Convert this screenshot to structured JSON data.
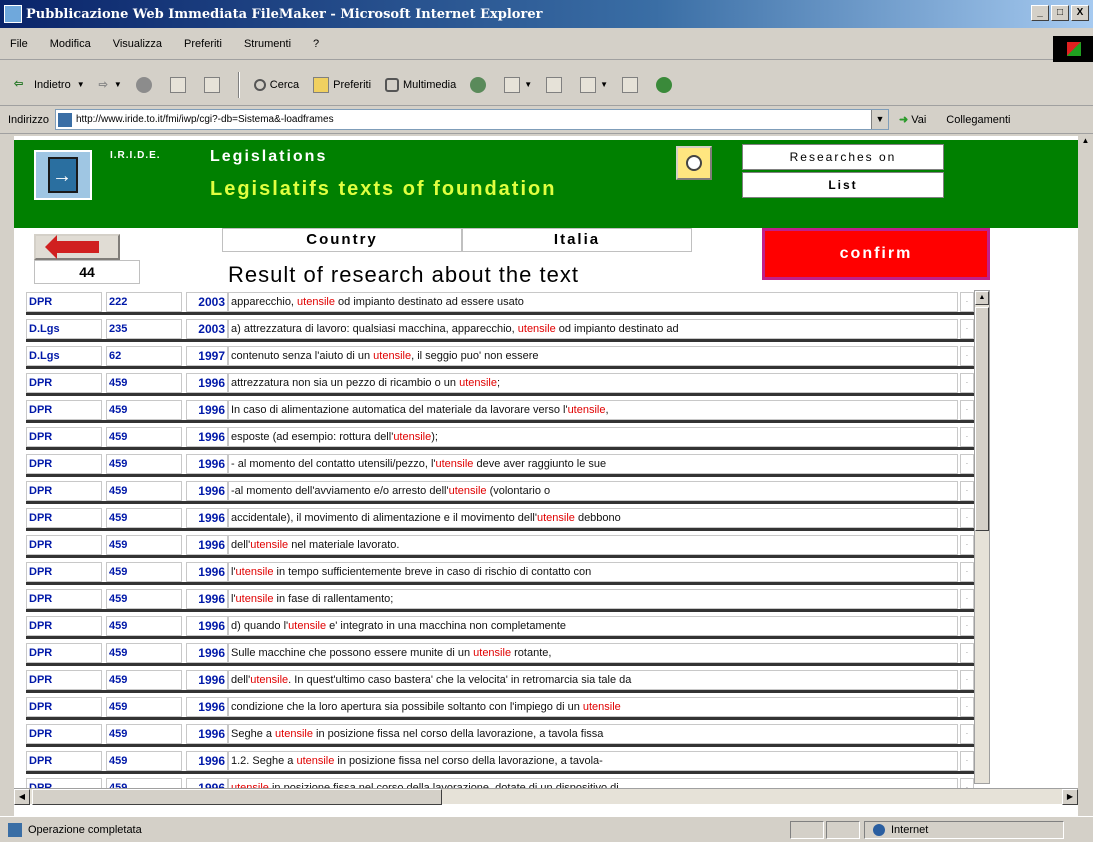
{
  "window": {
    "title": "Pubblicazione Web Immediata FileMaker - Microsoft Internet Explorer",
    "minimize": "_",
    "maximize": "□",
    "close": "X"
  },
  "menu": [
    "File",
    "Modifica",
    "Visualizza",
    "Preferiti",
    "Strumenti",
    "?"
  ],
  "toolbar": {
    "back": "Indietro",
    "search": "Cerca",
    "favorites": "Preferiti",
    "multimedia": "Multimedia"
  },
  "address": {
    "label": "Indirizzo",
    "url": "http://www.iride.to.it/fmi/iwp/cgi?-db=Sistema&-loadframes",
    "go": "Vai",
    "links": "Collegamenti"
  },
  "page": {
    "org": "I.R.I.D.E.",
    "section": "Legislations",
    "subtitle": "Legislatifs texts of foundation",
    "researches_label": "Researches on",
    "list_label": "List",
    "country_label": "Country",
    "country_value": "Italia",
    "confirm_label": "confirm",
    "result_count": "44",
    "result_title": "Result of research about the text"
  },
  "results": [
    {
      "type": "DPR",
      "number": "222",
      "year": "2003",
      "pre": "apparecchio, ",
      "hl": "utensile",
      "post": " od impianto destinato ad essere usato"
    },
    {
      "type": "D.Lgs",
      "number": "235",
      "year": "2003",
      "pre": "a) attrezzatura di lavoro: qualsiasi macchina, apparecchio, ",
      "hl": "utensile",
      "post": " od impianto destinato ad"
    },
    {
      "type": "D.Lgs",
      "number": "62",
      "year": "1997",
      "pre": "contenuto senza l'aiuto di un ",
      "hl": "utensile",
      "post": ", il seggio puo' non essere"
    },
    {
      "type": "DPR",
      "number": "459",
      "year": "1996",
      "pre": "attrezzatura non sia un pezzo di ricambio o un ",
      "hl": "utensile",
      "post": ";"
    },
    {
      "type": "DPR",
      "number": "459",
      "year": "1996",
      "pre": "In caso di alimentazione automatica del materiale da lavorare verso l'",
      "hl": "utensile",
      "post": ","
    },
    {
      "type": "DPR",
      "number": "459",
      "year": "1996",
      "pre": "esposte (ad esempio: rottura dell'",
      "hl": "utensile",
      "post": ");"
    },
    {
      "type": "DPR",
      "number": "459",
      "year": "1996",
      "pre": "- al momento del contatto utensili/pezzo, l'",
      "hl": "utensile",
      "post": " deve aver raggiunto le sue"
    },
    {
      "type": "DPR",
      "number": "459",
      "year": "1996",
      "pre": "-al momento dell'avviamento e/o arresto dell'",
      "hl": "utensile",
      "post": " (volontario o"
    },
    {
      "type": "DPR",
      "number": "459",
      "year": "1996",
      "pre": "accidentale), il movimento di alimentazione e il movimento dell'",
      "hl": "utensile",
      "post": " debbono"
    },
    {
      "type": "DPR",
      "number": "459",
      "year": "1996",
      "pre": "dell'",
      "hl": "utensile",
      "post": " nel materiale lavorato."
    },
    {
      "type": "DPR",
      "number": "459",
      "year": "1996",
      "pre": "l'",
      "hl": "utensile",
      "post": " in tempo sufficientemente breve in caso di rischio di contatto con"
    },
    {
      "type": "DPR",
      "number": "459",
      "year": "1996",
      "pre": "l'",
      "hl": "utensile",
      "post": " in fase di rallentamento;"
    },
    {
      "type": "DPR",
      "number": "459",
      "year": "1996",
      "pre": "d) quando l'",
      "hl": "utensile",
      "post": " e' integrato in una macchina non completamente"
    },
    {
      "type": "DPR",
      "number": "459",
      "year": "1996",
      "pre": "Sulle macchine che possono essere munite di un ",
      "hl": "utensile",
      "post": " rotante,"
    },
    {
      "type": "DPR",
      "number": "459",
      "year": "1996",
      "pre": "dell'",
      "hl": "utensile",
      "post": ". In quest'ultimo caso bastera' che la velocita' in retromarcia sia tale da"
    },
    {
      "type": "DPR",
      "number": "459",
      "year": "1996",
      "pre": "condizione che la loro apertura sia possibile soltanto con l'impiego di un ",
      "hl": "utensile",
      "post": ""
    },
    {
      "type": "DPR",
      "number": "459",
      "year": "1996",
      "pre": "Seghe a ",
      "hl": "utensile",
      "post": " in posizione fissa nel corso della lavorazione, a tavola fissa"
    },
    {
      "type": "DPR",
      "number": "459",
      "year": "1996",
      "pre": "1.2. Seghe a ",
      "hl": "utensile",
      "post": " in posizione fissa nel corso della lavorazione, a tavola-"
    },
    {
      "type": "DPR",
      "number": "459",
      "year": "1996",
      "pre": "",
      "hl": "utensile",
      "post": " in posizione fissa nel corso della lavorazione, dotate di un dispositivo di"
    }
  ],
  "status": {
    "text": "Operazione completata",
    "zone": "Internet"
  },
  "colors": {
    "header_green": "#008000",
    "subtitle_yellow": "#e0ff40",
    "confirm_red": "#ff0000",
    "link_blue": "#0018a8",
    "highlight_red": "#e00000"
  }
}
